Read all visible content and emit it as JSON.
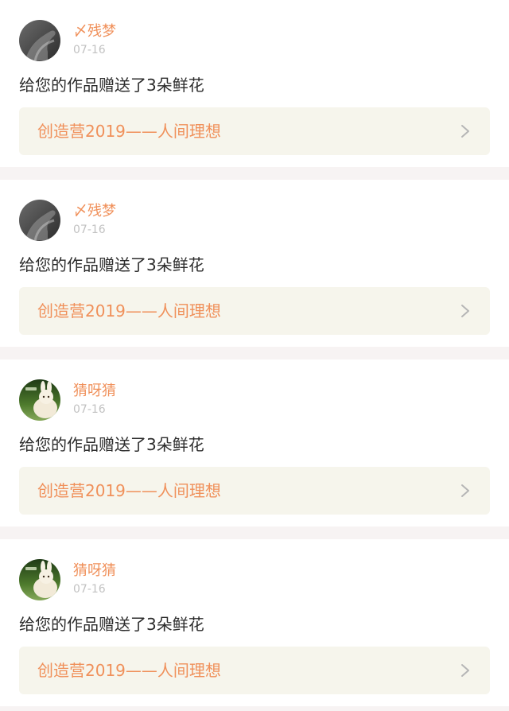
{
  "notifications": [
    {
      "username": "〆残梦",
      "date": "07-16",
      "message": "给您的作品赠送了3朵鲜花",
      "work_title": "创造营2019——人间理想",
      "avatar_icon": "dark-hand-avatar-icon"
    },
    {
      "username": "〆残梦",
      "date": "07-16",
      "message": "给您的作品赠送了3朵鲜花",
      "work_title": "创造营2019——人间理想",
      "avatar_icon": "dark-hand-avatar-icon"
    },
    {
      "username": "猜呀猜",
      "date": "07-16",
      "message": "给您的作品赠送了3朵鲜花",
      "work_title": "创造营2019——人间理想",
      "avatar_icon": "bunny-plush-avatar-icon"
    },
    {
      "username": "猜呀猜",
      "date": "07-16",
      "message": "给您的作品赠送了3朵鲜花",
      "work_title": "创造营2019——人间理想",
      "avatar_icon": "bunny-plush-avatar-icon"
    }
  ],
  "colors": {
    "accent": "#f0905a",
    "link_bg": "#f6f5ec",
    "divider": "#f7f3f3",
    "date": "#c2c2c2",
    "text": "#2b2b2b"
  }
}
